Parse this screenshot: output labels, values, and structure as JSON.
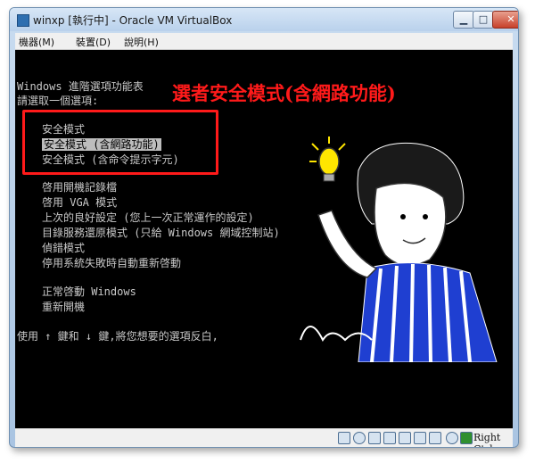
{
  "window": {
    "title": "winxp [執行中] - Oracle VM VirtualBox",
    "minimize_glyph": "▁",
    "maximize_glyph": "□",
    "close_glyph": "✕"
  },
  "menubar": {
    "items": [
      "機器(M)",
      "裝置(D)",
      "說明(H)"
    ]
  },
  "boot_menu": {
    "heading_line1": "Windows 進階選項功能表",
    "heading_line2": "請選取一個選項:",
    "safe_mode_options": [
      "安全模式",
      "安全模式 (含網路功能)",
      "安全模式 (含命令提示字元)"
    ],
    "selected_index": 1,
    "other_options": [
      "啓用開機記錄檔",
      "啓用 VGA 模式",
      "上次的良好設定 (您上一次正常運作的設定)",
      "目錄服務還原模式 (只給 Windows 網域控制站)",
      "偵錯模式",
      "停用系統失敗時自動重新啓動"
    ],
    "start_options": [
      "正常啓動 Windows",
      "重新開機"
    ],
    "instruction": "使用 ↑ 鍵和 ↓ 鍵,將您想要的選項反白,"
  },
  "annotation": {
    "title": "選者安全模式(含網路功能)",
    "accent_color": "#ff1a1a"
  },
  "statusbar": {
    "host_key": "Right Ctrl",
    "icons": [
      "hard-disk-icon",
      "cd-icon",
      "usb-icon",
      "network-icon",
      "shared-folder-icon",
      "display-icon",
      "capture-icon",
      "mouse-integration-icon",
      "keyboard-icon"
    ]
  }
}
